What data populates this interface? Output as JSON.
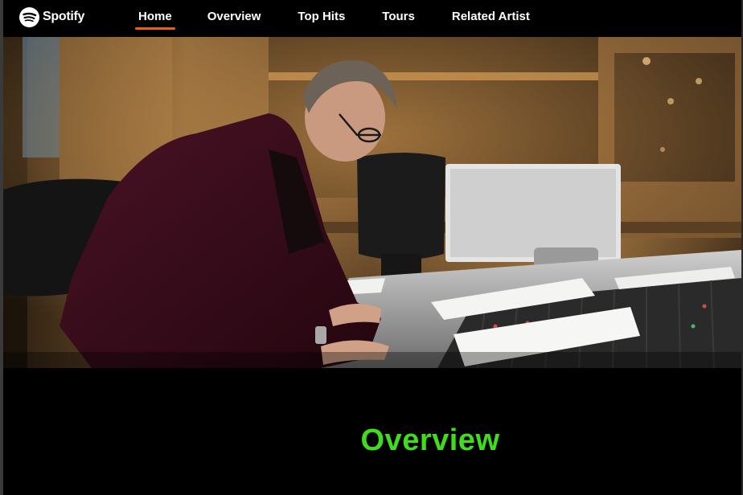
{
  "brand": {
    "name": "Spotify",
    "logo_icon": "spotify-logo-icon"
  },
  "nav": {
    "items": [
      {
        "label": "Home",
        "active": true
      },
      {
        "label": "Overview",
        "active": false
      },
      {
        "label": "Top Hits",
        "active": false
      },
      {
        "label": "Tours",
        "active": false
      },
      {
        "label": "Related Artist",
        "active": false
      }
    ],
    "active_underline_color": "#e8601c"
  },
  "hero": {
    "image_alt": "Musician at a studio mixing console"
  },
  "overview": {
    "title": "Overview",
    "title_color": "#3fdd1e"
  }
}
